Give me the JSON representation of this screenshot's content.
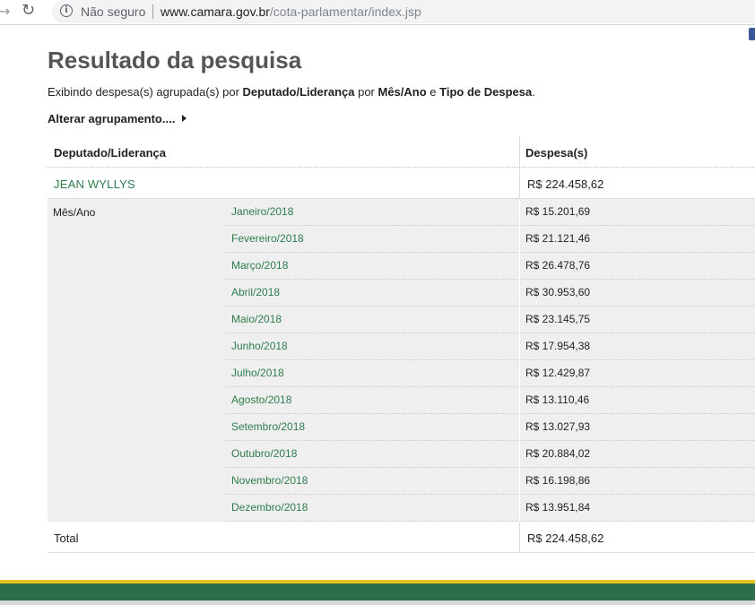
{
  "browser": {
    "security_label": "Não seguro",
    "url_host": "www.camara.gov.br",
    "url_path": "/cota-parlamentar/index.jsp"
  },
  "page": {
    "title": "Resultado da pesquisa",
    "subtitle_prefix": "Exibindo despesa(s) agrupada(s) por ",
    "subtitle_group1": "Deputado/Liderança",
    "subtitle_mid1": " por ",
    "subtitle_group2": "Mês/Ano",
    "subtitle_mid2": " e ",
    "subtitle_group3": "Tipo de Despesa",
    "subtitle_end": ".",
    "change_grouping": "Alterar agrupamento...."
  },
  "table": {
    "col_deputado": "Deputado/Liderança",
    "col_despesa": "Despesa(s)",
    "deputado_name": "JEAN WYLLYS",
    "deputado_total": "R$ 224.458,62",
    "months_label": "Mês/Ano",
    "months": [
      {
        "month": "Janeiro/2018",
        "value": "R$ 15.201,69"
      },
      {
        "month": "Fevereiro/2018",
        "value": "R$ 21.121,46"
      },
      {
        "month": "Março/2018",
        "value": "R$ 26.478,76"
      },
      {
        "month": "Abril/2018",
        "value": "R$ 30.953,60"
      },
      {
        "month": "Maio/2018",
        "value": "R$ 23.145,75"
      },
      {
        "month": "Junho/2018",
        "value": "R$ 17.954,38"
      },
      {
        "month": "Julho/2018",
        "value": "R$ 12.429,87"
      },
      {
        "month": "Agosto/2018",
        "value": "R$ 13.110,46"
      },
      {
        "month": "Setembro/2018",
        "value": "R$ 13.027,93"
      },
      {
        "month": "Outubro/2018",
        "value": "R$ 20.884,02"
      },
      {
        "month": "Novembro/2018",
        "value": "R$ 16.198,86"
      },
      {
        "month": "Dezembro/2018",
        "value": "R$ 13.951,84"
      }
    ],
    "total_label": "Total",
    "total_value": "R$ 224.458,62"
  },
  "colors": {
    "link_green": "#2e7d4f",
    "footer_green": "#2e6f4a",
    "footer_yellow": "#e8c21d"
  }
}
